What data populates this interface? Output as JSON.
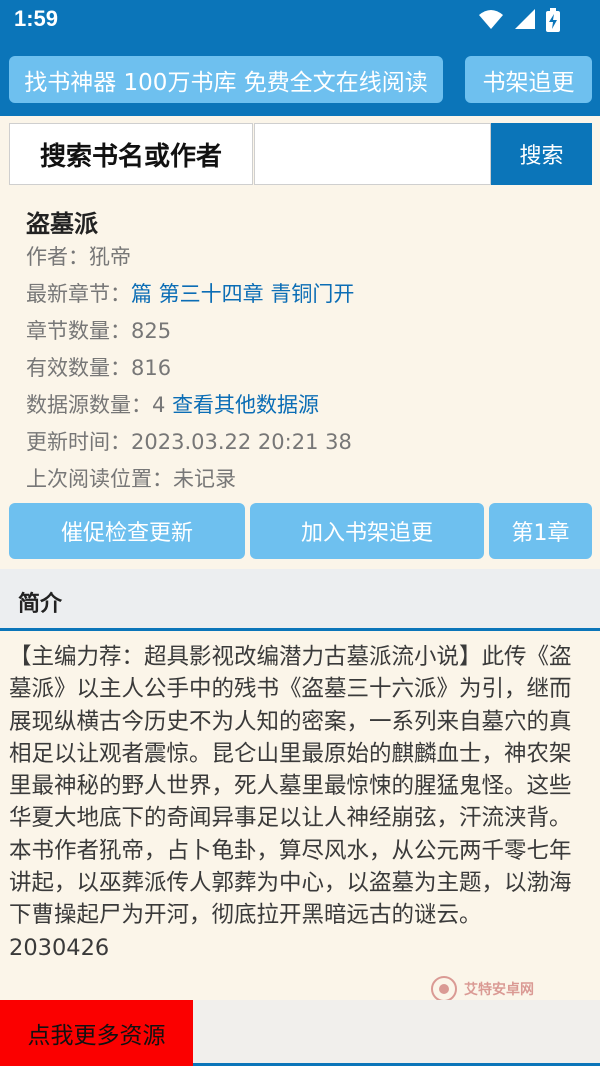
{
  "status_bar": {
    "time": "1:59"
  },
  "header": {
    "banner": "找书神器 100万书库 免费全文在线阅读",
    "bookshelf_button": "书架追更"
  },
  "search": {
    "label": "搜索书名或作者",
    "input_value": "",
    "button": "搜索"
  },
  "book": {
    "title": "盗墓派",
    "author_label": "作者：",
    "author": "犼帝",
    "latest_label": "最新章节：",
    "latest": "篇 第三十四章 青铜门开",
    "chapters_label": "章节数量：",
    "chapters": "825",
    "valid_label": "有效数量：",
    "valid": "816",
    "sources_label": "数据源数量：",
    "sources": "4",
    "sources_link": "查看其他数据源",
    "updated_label": "更新时间：",
    "updated": "2023.03.22 20:21 38",
    "last_read_label": "上次阅读位置：",
    "last_read": "未记录"
  },
  "actions": {
    "urge": "催促检查更新",
    "add": "加入书架追更",
    "chapter1": "第1章"
  },
  "intro": {
    "title": "简介",
    "text": "【主编力荐：超具影视改编潜力古墓派流小说】此传《盗墓派》以主人公手中的残书《盗墓三十六派》为引，继而展现纵横古今历史不为人知的密案，一系列来自墓穴的真相足以让观者震惊。昆仑山里最原始的麒麟血士，神农架里最神秘的野人世界，死人墓里最惊悚的腥猛鬼怪。这些华夏大地底下的奇闻异事足以让人神经崩弦，汗流浃背。本书作者犼帝，占卜龟卦，算尽风水，从公元两千零七年讲起，以巫葬派传人郭葬为中心，以盗墓为主题，以渤海下曹操起尸为开河，彻底拉开黑暗远古的谜云。 2030426"
  },
  "watermark": {
    "text": "艾特安卓网"
  },
  "bottom": {
    "more_button": "点我更多资源"
  },
  "colors": {
    "primary": "#0b75b9",
    "light_button": "#6ec0ef",
    "link": "#0b6db5",
    "background": "#fbf5e9",
    "red_button": "#fb0000"
  },
  "icons": [
    "wifi-icon",
    "signal-icon",
    "battery-icon"
  ]
}
